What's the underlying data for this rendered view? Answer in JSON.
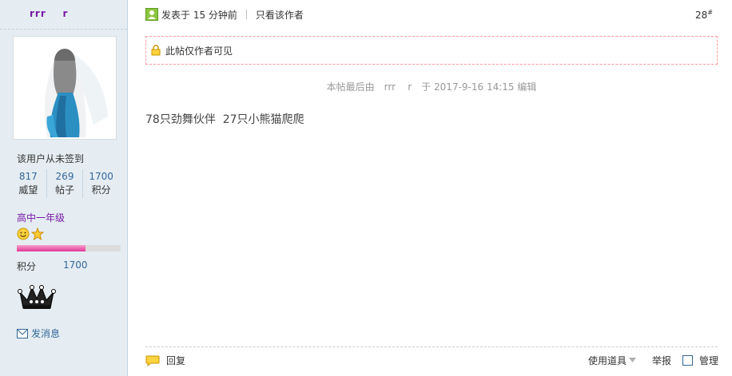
{
  "user": {
    "name": "rrr    r",
    "checkin_status": "该用户从未签到",
    "stats": [
      {
        "value": "817",
        "label": "威望"
      },
      {
        "value": "269",
        "label": "帖子"
      },
      {
        "value": "1700",
        "label": "积分"
      }
    ],
    "grade": "高中一年级",
    "credit_progress": 0.66,
    "credit_label": "积分",
    "credit_value": "1700",
    "send_message_label": "发消息",
    "medal_icons": [
      "smiley-medal-icon",
      "star-medal-icon"
    ],
    "badge_icon": "crown-badge-icon"
  },
  "post": {
    "time": "发表于 15 分钟前",
    "only_author": "只看该作者",
    "floor": "28",
    "floor_mark": "#",
    "locked_notice": "此帖仅作者可见",
    "edited_prefix": "本帖最后由",
    "edited_user": "rrr    r",
    "edited_suffix": "于 2017-9-16 14:15 编辑",
    "content": "78只劲舞伙伴  27只小熊猫爬爬"
  },
  "footer": {
    "reply": "回复",
    "tools": "使用道具",
    "report": "举报",
    "manage": "管理"
  },
  "colors": {
    "sidebar_bg": "#e5edf2",
    "link_blue": "#336699",
    "grade_purple": "#7a1aa8",
    "locked_border": "#ff9a9a",
    "progress_pink": "#e0389a"
  }
}
